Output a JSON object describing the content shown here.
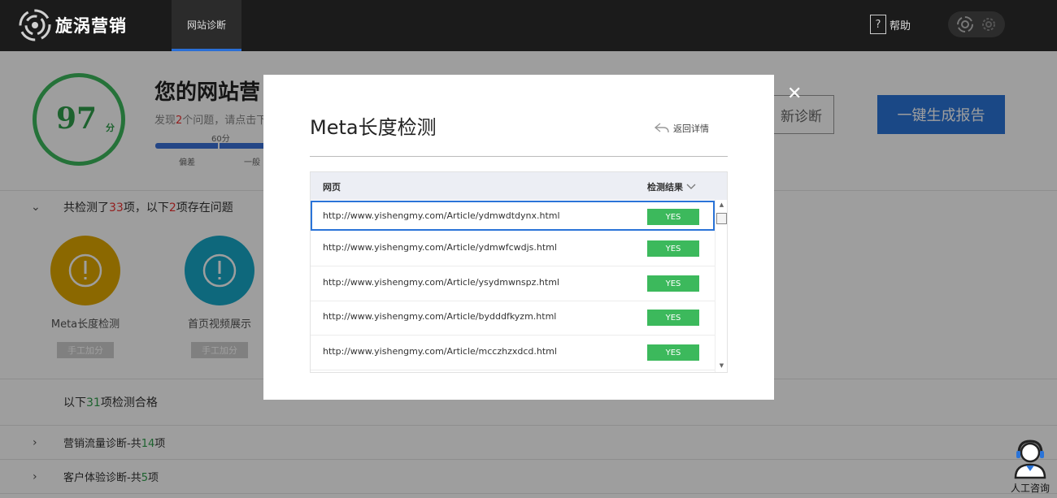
{
  "header": {
    "logo_text": "旋涡营销",
    "nav_tab": "网站诊断",
    "help_label": "帮助",
    "help_icon_char": "?"
  },
  "summary": {
    "score": "97",
    "score_unit": "分",
    "title": "您的网站营",
    "desc_prefix": "发现",
    "desc_count": "2",
    "desc_suffix": "个问题，请点击下",
    "bar_label": "60分",
    "bar_low": "偏差",
    "bar_mid": "一般",
    "redo_button": "新诊断",
    "report_button": "一键生成报告"
  },
  "problems": {
    "prefix": "共检测了",
    "total": "33",
    "middle": "项，以下",
    "count": "2",
    "suffix": "项存在问题",
    "items": [
      {
        "label": "Meta长度检测",
        "button": "手工加分",
        "color": "#e0a800"
      },
      {
        "label": "首页视频展示",
        "button": "手工加分",
        "color": "#17a8c8"
      }
    ]
  },
  "passed": {
    "prefix": "以下",
    "count": "31",
    "suffix": "项检测合格"
  },
  "categories": [
    {
      "prefix": "营销流量诊断-共",
      "count": "14",
      "suffix": "项"
    },
    {
      "prefix": "客户体验诊断-共",
      "count": "5",
      "suffix": "项"
    }
  ],
  "modal": {
    "title": "Meta长度检测",
    "back_label": "返回详情",
    "col_page": "网页",
    "col_result": "检测结果",
    "rows": [
      {
        "url": "http://www.yishengmy.com/Article/ydmwdtdynx.html",
        "result": "YES"
      },
      {
        "url": "http://www.yishengmy.com/Article/ydmwfcwdjs.html",
        "result": "YES"
      },
      {
        "url": "http://www.yishengmy.com/Article/ysydmwnspz.html",
        "result": "YES"
      },
      {
        "url": "http://www.yishengmy.com/Article/bydddfkyzm.html",
        "result": "YES"
      },
      {
        "url": "http://www.yishengmy.com/Article/mcczhzxdcd.html",
        "result": "YES"
      }
    ]
  },
  "consult": {
    "label": "人工咨询"
  },
  "colors": {
    "accent": "#2b74d8",
    "success": "#3cb95c",
    "warning": "#e0a800",
    "danger": "#e33333"
  }
}
